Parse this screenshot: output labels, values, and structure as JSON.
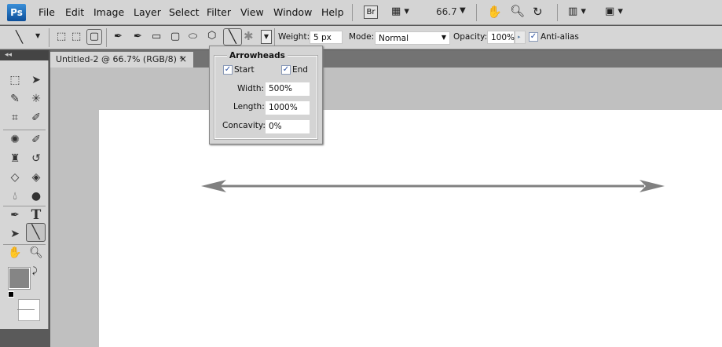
{
  "app": {
    "logo": "Ps"
  },
  "menu": [
    "File",
    "Edit",
    "Image",
    "Layer",
    "Select",
    "Filter",
    "View",
    "Window",
    "Help"
  ],
  "appbar": {
    "bridge": "Br",
    "zoom": "66.7"
  },
  "options": {
    "weight_label": "Weight:",
    "weight": "5 px",
    "mode_label": "Mode:",
    "mode": "Normal",
    "opacity_label": "Opacity:",
    "opacity": "100%",
    "antialias_label": "Anti-alias",
    "antialias": true
  },
  "arrowheads": {
    "title": "Arrowheads",
    "start_label": "Start",
    "start": true,
    "end_label": "End",
    "end": true,
    "width_label": "Width:",
    "width": "500%",
    "length_label": "Length:",
    "length": "1000%",
    "concavity_label": "Concavity:",
    "concavity": "0%"
  },
  "document": {
    "tab_title": "Untitled-2 @ 66.7% (RGB/8) *",
    "close": "×"
  },
  "colors": {
    "foreground": "#858585",
    "background": "#ffffff",
    "line": "#808080"
  }
}
